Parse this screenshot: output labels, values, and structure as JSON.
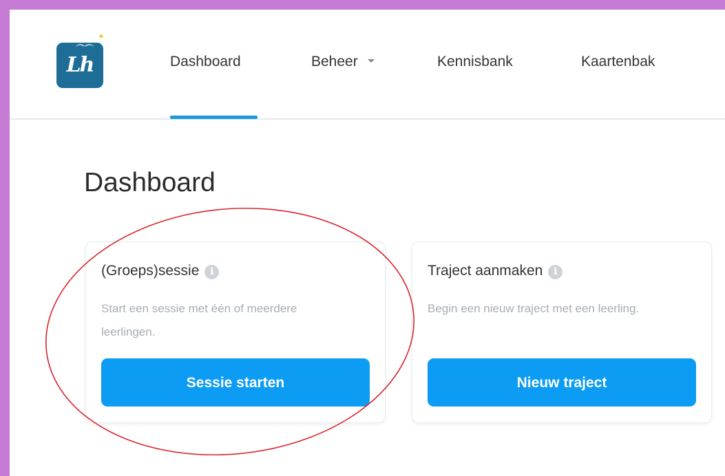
{
  "nav": {
    "logo_text": "Lh",
    "items": [
      {
        "label": "Dashboard",
        "active": true
      },
      {
        "label": "Beheer",
        "has_dropdown": true
      },
      {
        "label": "Kennisbank"
      },
      {
        "label": "Kaartenbak"
      }
    ]
  },
  "page": {
    "title": "Dashboard"
  },
  "cards": [
    {
      "title": "(Groeps)sessie",
      "info_icon": "i",
      "description": "Start een sessie met één of meerdere leerlingen.",
      "button_label": "Sessie starten"
    },
    {
      "title": "Traject aanmaken",
      "info_icon": "i",
      "description": "Begin een nieuw traject met een leerling.",
      "button_label": "Nieuw traject"
    }
  ],
  "colors": {
    "frame": "#c77ad4",
    "brand": "#1d6d96",
    "accent": "#1e9ad6",
    "button": "#0c9cf3",
    "annotation": "#d9262c"
  }
}
